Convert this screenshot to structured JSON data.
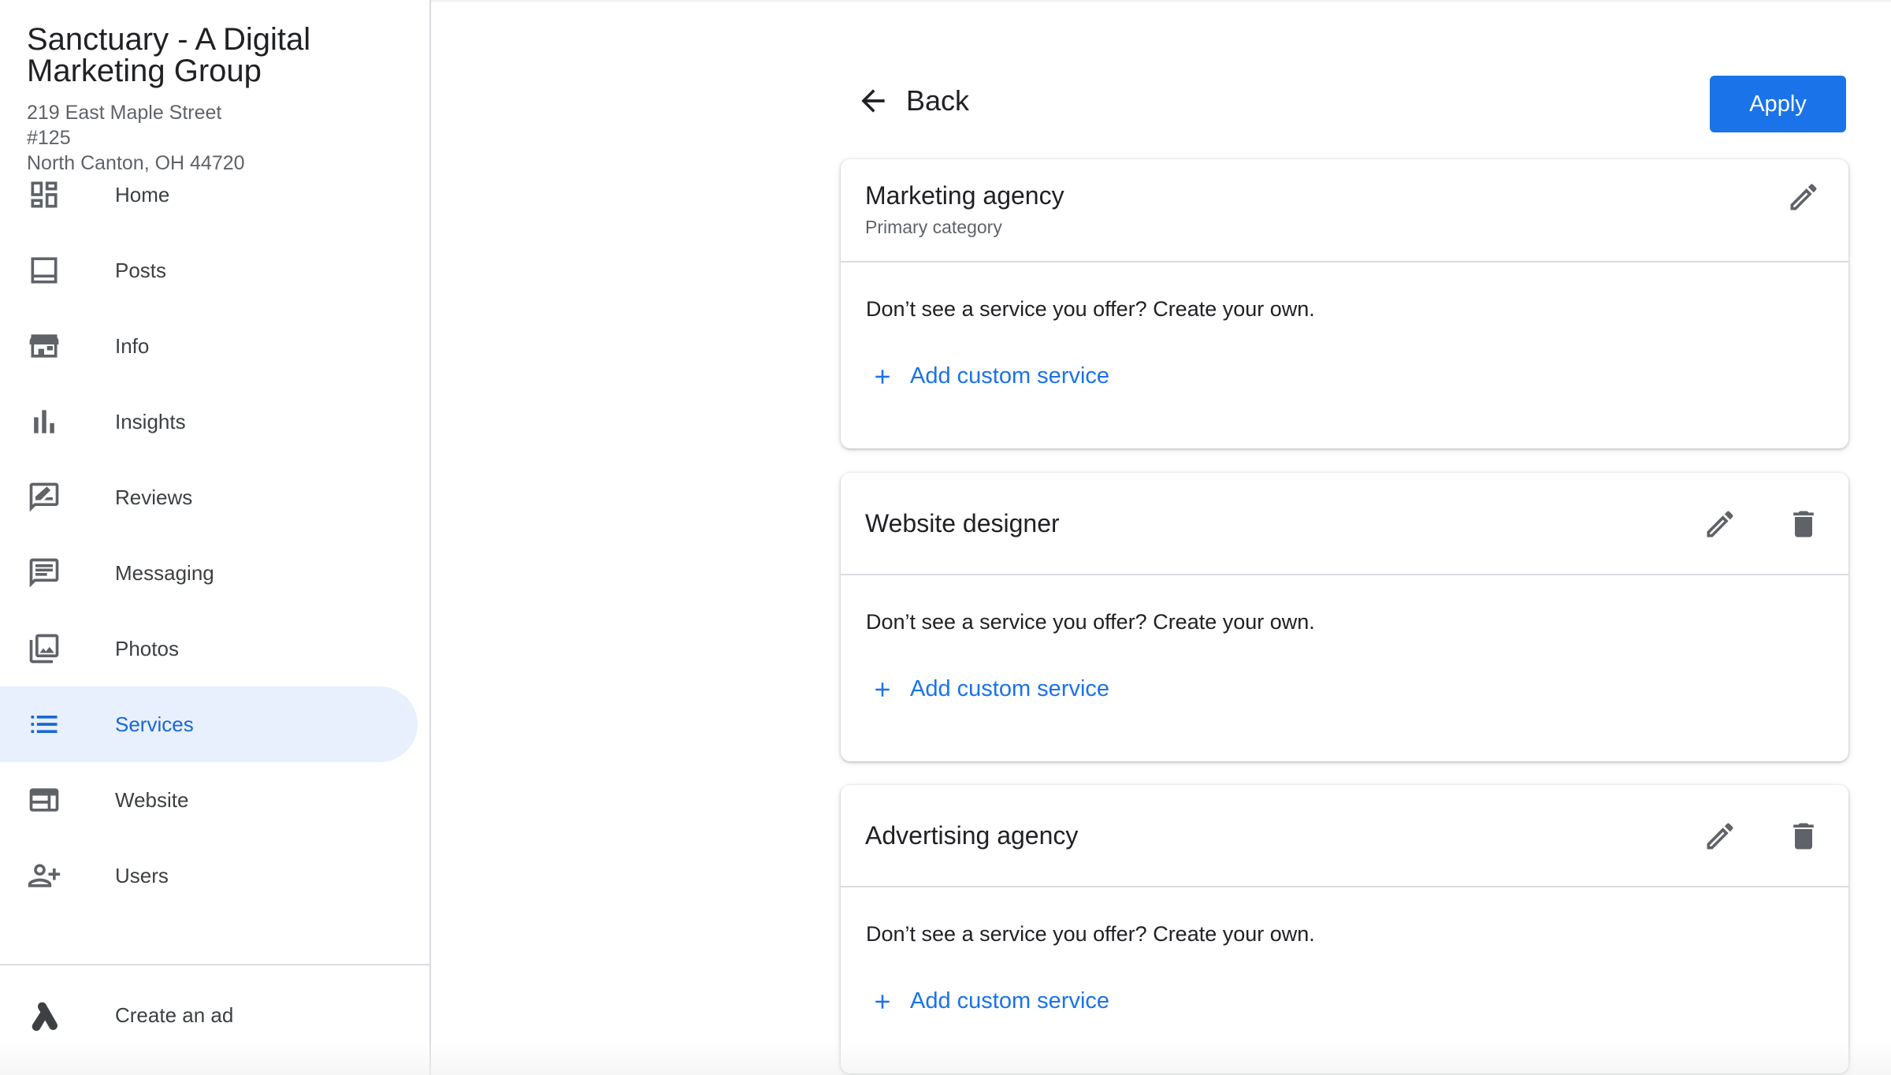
{
  "business": {
    "name": "Sanctuary - A Digital Marketing Group",
    "address_line1": "219 East Maple Street",
    "address_line2": "#125",
    "address_line3": "North Canton, OH 44720"
  },
  "sidebar": {
    "items": [
      {
        "label": "Home",
        "icon": "dashboard-icon"
      },
      {
        "label": "Posts",
        "icon": "posts-icon"
      },
      {
        "label": "Info",
        "icon": "storefront-icon"
      },
      {
        "label": "Insights",
        "icon": "bar-chart-icon"
      },
      {
        "label": "Reviews",
        "icon": "rate-review-icon"
      },
      {
        "label": "Messaging",
        "icon": "message-icon"
      },
      {
        "label": "Photos",
        "icon": "photo-library-icon"
      },
      {
        "label": "Services",
        "icon": "list-icon",
        "active": true
      },
      {
        "label": "Website",
        "icon": "web-icon"
      },
      {
        "label": "Users",
        "icon": "person-add-icon"
      }
    ],
    "create_ad": {
      "label": "Create an ad",
      "icon": "google-ads-icon"
    }
  },
  "header": {
    "back_label": "Back",
    "apply_label": "Apply"
  },
  "categories": [
    {
      "title": "Marketing agency",
      "subtitle": "Primary category",
      "prompt": "Don’t see a service you offer? Create your own.",
      "add_label": "Add custom service"
    },
    {
      "title": "Website designer",
      "prompt": "Don’t see a service you offer? Create your own.",
      "add_label": "Add custom service"
    },
    {
      "title": "Advertising agency",
      "prompt": "Don’t see a service you offer? Create your own.",
      "add_label": "Add custom service"
    }
  ],
  "colors": {
    "accent": "#1a73e8",
    "active_bg": "#e8f0fe",
    "active_text": "#1967d2",
    "icon_gray": "#5f6368"
  }
}
